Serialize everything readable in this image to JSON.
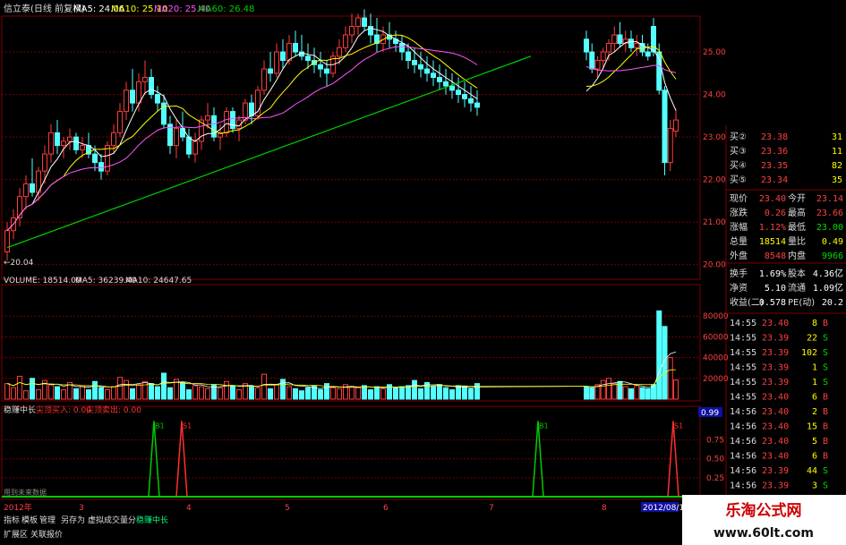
{
  "header": {
    "title": "信立泰(日线 前复权)",
    "ma5": "MA5: 24.06",
    "ma10": "MA10: 25.10",
    "ma20": "MA20: 25.40",
    "ma60": "MA60: 26.48"
  },
  "price_axis": [
    "25.00",
    "24.00",
    "23.00",
    "22.00",
    "21.00",
    "20.00"
  ],
  "low_marker": "←20.04",
  "volume_header": {
    "volume": "VOLUME: 18514.00",
    "ma5": "MA5: 36239.40",
    "ma10": "MA10: 24647.65"
  },
  "volume_axis": [
    "80000",
    "60000",
    "40000",
    "20000"
  ],
  "indicator_header": {
    "name": "稳赚中长",
    "buy": "尖顶买入: 0.00",
    "sell": "尖顶卖出: 0.00"
  },
  "indicator_value": "0.99",
  "indicator_axis": [
    "0.75",
    "0.50",
    "0.25"
  ],
  "signals": [
    "B1",
    "S1",
    "B1",
    "S1"
  ],
  "indicator_footer": "用到未来数据",
  "date_axis": {
    "labels": [
      "2012年",
      "3",
      "4",
      "5",
      "6",
      "7",
      "8"
    ],
    "end": "2012/08/1"
  },
  "bottom_tabs": [
    "指标",
    "模板",
    "管理",
    "另存为",
    "虚拟成交量分",
    "稳赚中长"
  ],
  "extension_tabs": [
    "扩展区",
    "关联报价"
  ],
  "quote": {
    "bids": [
      {
        "label": "买②",
        "price": "23.38",
        "vol": "31"
      },
      {
        "label": "买③",
        "price": "23.36",
        "vol": "11"
      },
      {
        "label": "买④",
        "price": "23.35",
        "vol": "82"
      },
      {
        "label": "买⑤",
        "price": "23.34",
        "vol": "35"
      }
    ],
    "stats": [
      {
        "l1": "现价",
        "v1": "23.40",
        "l2": "今开",
        "v2": "23.14",
        "c1": "#ff4040",
        "c2": "#ff4040"
      },
      {
        "l1": "涨跌",
        "v1": "0.26",
        "l2": "最高",
        "v2": "23.66",
        "c1": "#ff4040",
        "c2": "#ff4040"
      },
      {
        "l1": "涨幅",
        "v1": "1.12%",
        "l2": "最低",
        "v2": "23.00",
        "c1": "#ff4040",
        "c2": "#00dd00"
      },
      {
        "l1": "总量",
        "v1": "18514",
        "l2": "量比",
        "v2": "0.49",
        "c1": "#ffff00",
        "c2": "#ffff00"
      },
      {
        "l1": "外盘",
        "v1": "8548",
        "l2": "内盘",
        "v2": "9966",
        "c1": "#ff4040",
        "c2": "#00dd00"
      },
      {
        "l1": "换手",
        "v1": "1.69%",
        "l2": "股本",
        "v2": "4.36亿",
        "c1": "#ffffff",
        "c2": "#ffffff"
      },
      {
        "l1": "净资",
        "v1": "5.10",
        "l2": "流通",
        "v2": "1.09亿",
        "c1": "#ffffff",
        "c2": "#ffffff"
      },
      {
        "l1": "收益(二)",
        "v1": "0.578",
        "l2": "PE(动)",
        "v2": "20.2",
        "c1": "#ffffff",
        "c2": "#ffffff"
      }
    ],
    "ticks": [
      {
        "time": "14:55",
        "price": "23.40",
        "vol": "8",
        "side": "B"
      },
      {
        "time": "14:55",
        "price": "23.39",
        "vol": "22",
        "side": "S"
      },
      {
        "time": "14:55",
        "price": "23.39",
        "vol": "102",
        "side": "S"
      },
      {
        "time": "14:55",
        "price": "23.39",
        "vol": "1",
        "side": "S"
      },
      {
        "time": "14:55",
        "price": "23.39",
        "vol": "1",
        "side": "S"
      },
      {
        "time": "14:55",
        "price": "23.40",
        "vol": "6",
        "side": "B"
      },
      {
        "time": "14:56",
        "price": "23.40",
        "vol": "2",
        "side": "B"
      },
      {
        "time": "14:56",
        "price": "23.40",
        "vol": "15",
        "side": "B"
      },
      {
        "time": "14:56",
        "price": "23.40",
        "vol": "5",
        "side": "B"
      },
      {
        "time": "14:56",
        "price": "23.40",
        "vol": "6",
        "side": "B"
      },
      {
        "time": "14:56",
        "price": "23.39",
        "vol": "44",
        "side": "S"
      },
      {
        "time": "14:56",
        "price": "23.39",
        "vol": "3",
        "side": "S"
      }
    ]
  },
  "watermark": {
    "line1": "乐淘公式网",
    "line2": "www.60lt.com"
  },
  "colors": {
    "up": "#ff3c3c",
    "down": "#54ffff",
    "ma5": "#ffffff",
    "ma10": "#ffff00",
    "ma20": "#ff55ff",
    "ma60": "#00cc00",
    "grid": "#7a0000",
    "buy": "#00cc00",
    "sell": "#ff3030"
  },
  "chart_data": {
    "type": "candlestick",
    "price_ylim": [
      19.7,
      25.8
    ],
    "volume_ylim": [
      0,
      100000
    ],
    "indicator_ylim": [
      0,
      1.1
    ],
    "candles": [
      [
        20.3,
        21.0,
        20.1,
        20.8
      ],
      [
        20.8,
        21.3,
        20.6,
        21.1
      ],
      [
        21.1,
        21.8,
        20.9,
        21.6
      ],
      [
        21.6,
        22.1,
        21.3,
        21.9
      ],
      [
        21.9,
        22.5,
        21.6,
        21.7
      ],
      [
        21.7,
        22.3,
        21.5,
        22.2
      ],
      [
        22.2,
        22.8,
        21.9,
        22.6
      ],
      [
        22.6,
        23.3,
        22.4,
        23.1
      ],
      [
        23.1,
        23.4,
        22.6,
        22.8
      ],
      [
        22.8,
        23.0,
        22.5,
        22.9
      ],
      [
        22.9,
        23.2,
        22.7,
        23.0
      ],
      [
        23.0,
        23.1,
        22.6,
        22.7
      ],
      [
        22.7,
        23.0,
        22.5,
        22.8
      ],
      [
        22.8,
        23.1,
        22.5,
        22.6
      ],
      [
        22.6,
        22.8,
        22.2,
        22.4
      ],
      [
        22.4,
        22.6,
        22.0,
        22.2
      ],
      [
        22.2,
        22.9,
        22.1,
        22.8
      ],
      [
        22.8,
        23.3,
        22.6,
        23.1
      ],
      [
        23.1,
        23.8,
        23.0,
        23.6
      ],
      [
        23.6,
        24.3,
        23.4,
        24.1
      ],
      [
        24.1,
        24.6,
        23.6,
        23.8
      ],
      [
        23.8,
        24.5,
        23.6,
        24.3
      ],
      [
        24.3,
        24.8,
        24.0,
        24.4
      ],
      [
        24.4,
        24.6,
        23.9,
        24.0
      ],
      [
        24.0,
        24.2,
        23.6,
        23.8
      ],
      [
        23.8,
        24.0,
        23.2,
        23.3
      ],
      [
        23.3,
        23.5,
        22.6,
        22.8
      ],
      [
        22.8,
        23.4,
        22.5,
        23.2
      ],
      [
        23.2,
        23.6,
        22.9,
        23.0
      ],
      [
        23.0,
        23.2,
        22.5,
        22.6
      ],
      [
        22.6,
        23.1,
        22.4,
        22.9
      ],
      [
        22.9,
        23.5,
        22.7,
        23.4
      ],
      [
        23.4,
        23.8,
        23.2,
        23.5
      ],
      [
        23.5,
        23.7,
        22.9,
        23.0
      ],
      [
        23.0,
        23.3,
        22.7,
        23.1
      ],
      [
        23.1,
        23.7,
        23.0,
        23.6
      ],
      [
        23.6,
        23.7,
        23.1,
        23.2
      ],
      [
        23.2,
        23.5,
        22.9,
        23.4
      ],
      [
        23.4,
        23.9,
        23.3,
        23.8
      ],
      [
        23.8,
        24.0,
        23.3,
        23.5
      ],
      [
        23.5,
        24.2,
        23.4,
        24.1
      ],
      [
        24.1,
        24.8,
        24.0,
        24.6
      ],
      [
        24.6,
        25.0,
        24.3,
        24.5
      ],
      [
        24.5,
        25.2,
        24.4,
        25.0
      ],
      [
        25.0,
        25.3,
        24.6,
        24.8
      ],
      [
        24.8,
        25.4,
        24.7,
        25.2
      ],
      [
        25.2,
        25.5,
        24.9,
        25.0
      ],
      [
        25.0,
        25.4,
        24.8,
        24.9
      ],
      [
        24.9,
        25.2,
        24.6,
        24.8
      ],
      [
        24.8,
        25.1,
        24.5,
        24.7
      ],
      [
        24.7,
        25.0,
        24.4,
        24.6
      ],
      [
        24.6,
        24.8,
        24.2,
        24.5
      ],
      [
        24.5,
        25.0,
        24.4,
        24.9
      ],
      [
        24.9,
        25.3,
        24.7,
        25.1
      ],
      [
        25.1,
        25.6,
        25.0,
        25.4
      ],
      [
        25.4,
        25.9,
        25.2,
        25.6
      ],
      [
        25.6,
        25.9,
        25.4,
        25.8
      ],
      [
        25.8,
        26.0,
        25.5,
        25.6
      ],
      [
        25.6,
        25.9,
        25.2,
        25.4
      ],
      [
        25.4,
        25.8,
        25.0,
        25.2
      ],
      [
        25.2,
        25.6,
        25.0,
        25.4
      ],
      [
        25.4,
        25.7,
        25.1,
        25.3
      ],
      [
        25.3,
        25.5,
        25.0,
        25.2
      ],
      [
        25.2,
        25.4,
        24.8,
        25.0
      ],
      [
        25.0,
        25.2,
        24.6,
        24.8
      ],
      [
        24.8,
        25.1,
        24.5,
        24.7
      ],
      [
        24.7,
        25.0,
        24.4,
        24.6
      ],
      [
        24.6,
        24.9,
        24.3,
        24.5
      ],
      [
        24.5,
        24.8,
        24.2,
        24.4
      ],
      [
        24.4,
        24.7,
        24.1,
        24.3
      ],
      [
        24.3,
        24.6,
        24.0,
        24.2
      ],
      [
        24.2,
        24.5,
        23.9,
        24.1
      ],
      [
        24.1,
        24.4,
        23.8,
        24.0
      ],
      [
        24.0,
        24.3,
        23.7,
        23.9
      ],
      [
        23.9,
        24.2,
        23.6,
        23.8
      ],
      [
        23.8,
        24.1,
        23.5,
        23.7
      ],
      [
        25.3,
        25.5,
        24.8,
        25.0
      ],
      [
        25.0,
        25.2,
        24.5,
        24.6
      ],
      [
        24.6,
        24.9,
        24.4,
        24.8
      ],
      [
        24.8,
        25.1,
        24.6,
        25.0
      ],
      [
        25.0,
        25.3,
        24.8,
        25.2
      ],
      [
        25.2,
        25.6,
        25.0,
        25.4
      ],
      [
        25.4,
        25.7,
        25.1,
        25.2
      ],
      [
        25.2,
        25.5,
        25.0,
        25.3
      ],
      [
        25.3,
        25.5,
        25.0,
        25.1
      ],
      [
        25.1,
        25.4,
        24.9,
        25.2
      ],
      [
        25.2,
        25.4,
        24.9,
        25.0
      ],
      [
        25.0,
        25.2,
        24.8,
        24.9
      ],
      [
        25.6,
        25.8,
        24.9,
        25.0
      ],
      [
        25.0,
        25.2,
        24.0,
        24.1
      ],
      [
        24.1,
        24.2,
        22.1,
        22.4
      ],
      [
        22.4,
        23.4,
        22.2,
        23.2
      ],
      [
        23.14,
        23.66,
        23.0,
        23.4
      ]
    ],
    "volumes": [
      15,
      11,
      22,
      8,
      20,
      9,
      18,
      14,
      12,
      9,
      16,
      10,
      13,
      9,
      17,
      11,
      9,
      12,
      21,
      18,
      10,
      14,
      17,
      15,
      12,
      25,
      11,
      19,
      16,
      9,
      13,
      12,
      10,
      14,
      11,
      17,
      13,
      9,
      15,
      12,
      11,
      24,
      10,
      14,
      19,
      12,
      10,
      8,
      11,
      13,
      9,
      15,
      11,
      10,
      14,
      12,
      11,
      13,
      9,
      12,
      10,
      14,
      11,
      12,
      13,
      18,
      10,
      16,
      12,
      14,
      11,
      9,
      13,
      12,
      10,
      15,
      12,
      11,
      14,
      18,
      20,
      15,
      17,
      12,
      10,
      13,
      11,
      10,
      14,
      85,
      70,
      40,
      18.5
    ],
    "ma60": [
      20.4,
      20.5,
      20.6,
      20.7,
      20.8,
      20.9,
      21.0,
      21.1,
      21.2,
      21.3,
      21.4,
      21.5,
      21.6,
      21.7,
      21.8,
      21.9,
      22.0,
      22.1,
      22.2,
      22.3,
      22.4,
      22.5,
      22.6,
      22.7,
      22.8,
      22.9,
      23.0,
      23.1,
      23.2,
      23.3,
      23.4,
      23.5,
      23.6,
      23.7,
      23.8,
      23.9,
      24.0,
      24.1,
      24.2,
      24.3,
      24.4,
      24.5,
      24.6,
      24.7,
      24.8,
      24.9
    ],
    "signal_bars": [
      40,
      45,
      145,
      175
    ]
  }
}
